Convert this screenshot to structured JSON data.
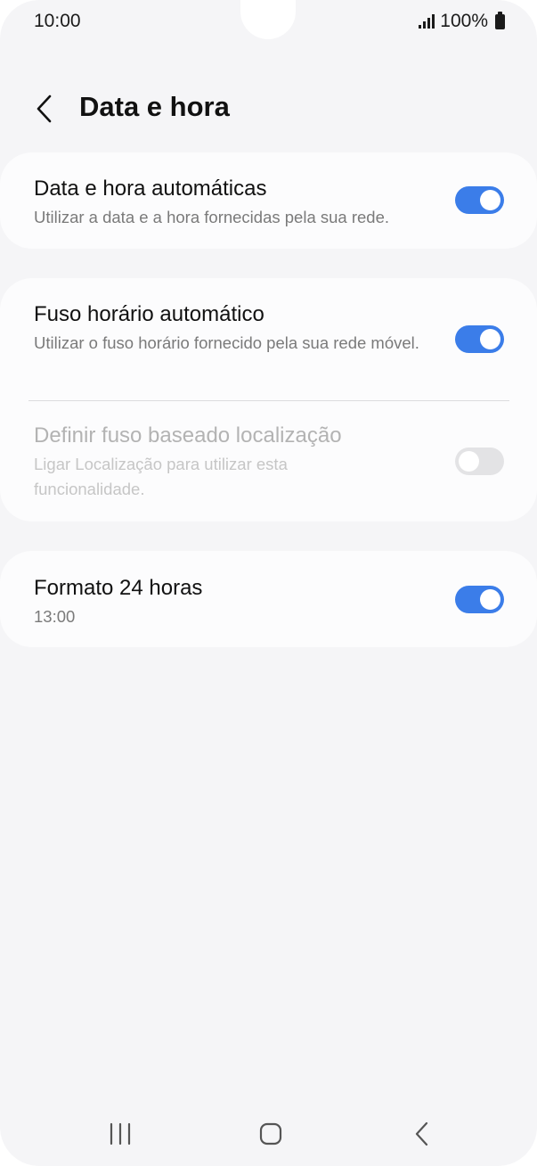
{
  "status_bar": {
    "time": "10:00",
    "battery": "100%",
    "icons": [
      "signal-icon",
      "battery-icon"
    ]
  },
  "header": {
    "back_icon": "chevron-left-icon",
    "title": "Data e hora"
  },
  "settings": {
    "auto_datetime": {
      "title": "Data e hora automáticas",
      "subtitle": "Utilizar a data e a hora fornecidas pela sua rede.",
      "toggle_on": true
    },
    "auto_timezone": {
      "title": "Fuso horário automático",
      "subtitle": "Utilizar o fuso horário fornecido pela sua rede móvel.",
      "toggle_on": true
    },
    "location_timezone": {
      "title": "Definir fuso baseado localização",
      "subtitle": "Ligar Localização para utilizar esta funcionalidade.",
      "toggle_on": false,
      "enabled": false
    },
    "format_24h": {
      "title": "Formato 24 horas",
      "subtitle": "13:00",
      "toggle_on": true
    }
  },
  "nav_bar": {
    "items": [
      "recents-icon",
      "home-icon",
      "back-icon"
    ]
  },
  "colors": {
    "accent": "#3b7de9",
    "background": "#f5f5f7",
    "card": "#fcfcfd",
    "toggle_off": "#e3e3e5"
  }
}
